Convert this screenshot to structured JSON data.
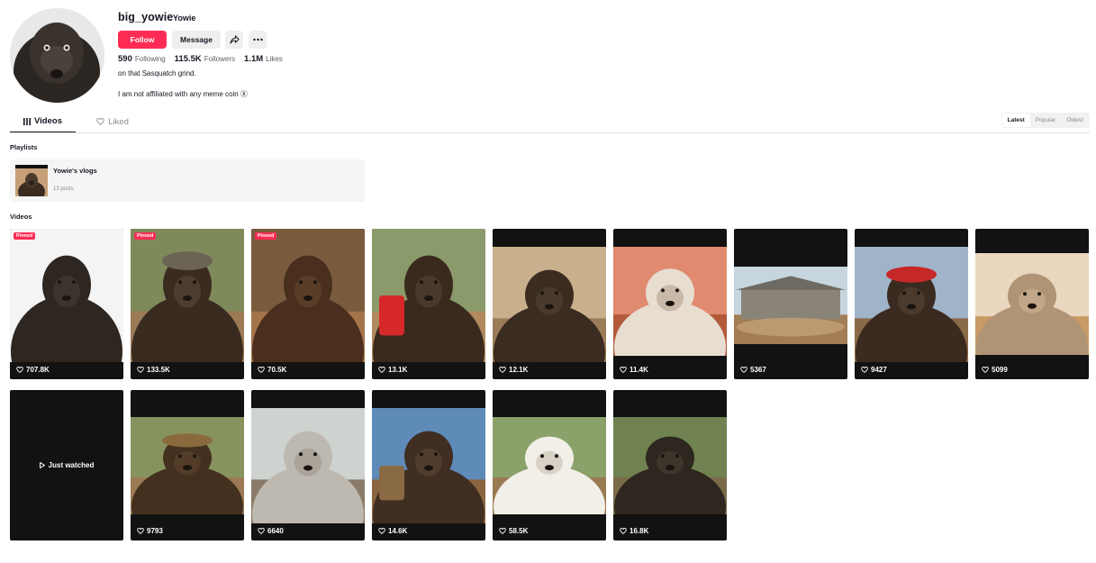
{
  "profile": {
    "username": "big_yowie",
    "nickname": "Yowie",
    "follow_label": "Follow",
    "message_label": "Message",
    "following_count": "590",
    "following_label": "Following",
    "followers_count": "115.5K",
    "followers_label": "Followers",
    "likes_count": "1.1M",
    "likes_label": "Likes",
    "bio_line1": "on that Sasquatch grind.",
    "bio_line2": "I am not affiliated with any meme coin Ⓧ"
  },
  "tabs": {
    "videos_label": "Videos",
    "liked_label": "Liked",
    "sort_options": [
      "Latest",
      "Popular",
      "Oldest"
    ],
    "sort_selected": "Latest"
  },
  "playlists": {
    "heading": "Playlists",
    "items": [
      {
        "title": "Yowie's vlogs",
        "count": "13 posts"
      }
    ]
  },
  "videos": {
    "heading": "Videos",
    "pinned_label": "Pinned",
    "just_watched_label": "Just watched",
    "items": [
      {
        "likes": "707.8K",
        "pinned": true
      },
      {
        "likes": "133.5K",
        "pinned": true
      },
      {
        "likes": "70.5K",
        "pinned": true
      },
      {
        "likes": "13.1K",
        "pinned": false
      },
      {
        "likes": "12.1K",
        "pinned": false
      },
      {
        "likes": "11.4K",
        "pinned": false
      },
      {
        "likes": "5367",
        "pinned": false
      },
      {
        "likes": "9427",
        "pinned": false
      },
      {
        "likes": "5099",
        "pinned": false
      },
      {
        "likes": "",
        "just_watched": true
      },
      {
        "likes": "9793",
        "pinned": false
      },
      {
        "likes": "6640",
        "pinned": false
      },
      {
        "likes": "14.6K",
        "pinned": false
      },
      {
        "likes": "58.5K",
        "pinned": false
      },
      {
        "likes": "16.8K",
        "pinned": false
      }
    ]
  },
  "colors": {
    "accent": "#fe2c55",
    "text": "#161823",
    "muted": "#8a8b91"
  }
}
